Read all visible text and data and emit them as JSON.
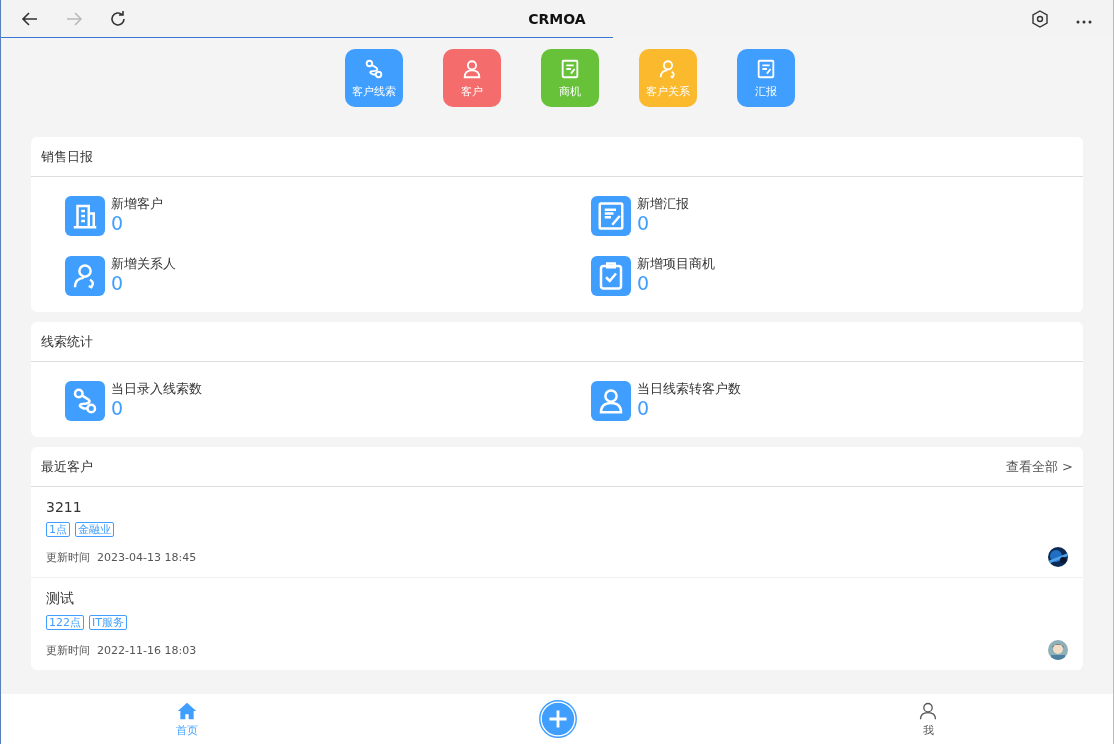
{
  "window": {
    "title": "CRMOA",
    "loading_bar": {
      "level": 0.55
    }
  },
  "quick_actions": [
    {
      "label": "客户线索",
      "color": "#409eff"
    },
    {
      "label": "客户",
      "color": "#f56c6c"
    },
    {
      "label": "商机",
      "color": "#67c23a"
    },
    {
      "label": "客户关系",
      "color": "#fbb92e"
    },
    {
      "label": "汇报",
      "color": "#409eff"
    }
  ],
  "sections": [
    {
      "title": "销售日报",
      "stats": [
        {
          "label": "新增客户",
          "value": "0"
        },
        {
          "label": "新增汇报",
          "value": "0"
        },
        {
          "label": "新增关系人",
          "value": "0"
        },
        {
          "label": "新增项目商机",
          "value": "0"
        }
      ]
    },
    {
      "title": "线索统计",
      "stats": [
        {
          "label": "当日录入线索数",
          "value": "0"
        },
        {
          "label": "当日线索转客户数",
          "value": "0"
        }
      ]
    }
  ],
  "recent_customers": {
    "title": "最近客户",
    "view_all": "查看全部 >",
    "items": [
      {
        "name": "3211",
        "tags": [
          "1点",
          "金融业"
        ],
        "updated_label": "更新时间",
        "updated": "2023-04-13 18:45"
      },
      {
        "name": "测试",
        "tags": [
          "122点",
          "IT服务"
        ],
        "updated_label": "更新时间",
        "updated": "2022-11-16 18:03"
      }
    ]
  },
  "bottom_nav": [
    {
      "kind": "tab",
      "label": "首页",
      "selected": true
    },
    {
      "kind": "add"
    },
    {
      "kind": "tab",
      "label": "我",
      "selected": false
    }
  ]
}
